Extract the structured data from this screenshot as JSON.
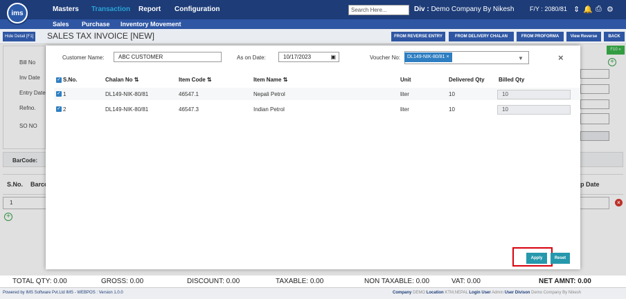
{
  "nav": {
    "menus": [
      "Masters",
      "Transaction",
      "Report",
      "Configuration"
    ],
    "active_menu": "Transaction",
    "submenus": [
      "Sales",
      "Purchase",
      "Inventory Movement"
    ],
    "search_placeholder": "Search Here...",
    "division_label": "Div :",
    "division_value": "Demo Company By Nikesh",
    "fiscal_year": "F/Y : 2080/81",
    "logo_text": "ims"
  },
  "titlebar": {
    "hide_detail": "Hide Detail [F1]",
    "title": "SALES TAX INVOICE [NEW]",
    "buttons": [
      "FROM REVERSE ENTRY",
      "FROM DELIVERY CHALAN",
      "FROM PROFORMA",
      "View Reverse",
      "BACK"
    ]
  },
  "form": {
    "labels": [
      "Bill No",
      "Inv Date",
      "Entry Date",
      "Refno.",
      "SO NO"
    ],
    "f10": "F10 «"
  },
  "barcode_label": "BarCode:",
  "grid": {
    "headers": [
      "S.No.",
      "Barcode",
      "p Date"
    ],
    "row_number": "1"
  },
  "modal": {
    "customer_label": "Customer Name:",
    "customer_value": "ABC CUSTOMER",
    "date_label": "As on Date:",
    "date_value": "10/17/2023",
    "voucher_label": "Voucher No:",
    "voucher_tag": "DL149-NIK-80/81",
    "columns": [
      "S.No.",
      "Chalan No",
      "Item Code",
      "Item Name",
      "Unit",
      "Delivered Qty",
      "Billed Qty"
    ],
    "rows": [
      {
        "sno": "1",
        "chalan": "DL149-NIK-80/81",
        "code": "46547.1",
        "name": "Nepali Petrol",
        "unit": "liter",
        "delivered": "10",
        "billed": "10"
      },
      {
        "sno": "2",
        "chalan": "DL149-NIK-80/81",
        "code": "46547.3",
        "name": "Indian Petrol",
        "unit": "liter",
        "delivered": "10",
        "billed": "10"
      }
    ],
    "apply": "Apply",
    "reset": "Reset"
  },
  "totals": {
    "qty": "TOTAL QTY: 0.00",
    "gross": "GROSS: 0.00",
    "discount": "DISCOUNT: 0.00",
    "taxable": "TAXABLE: 0.00",
    "non_taxable": "NON TAXABLE: 0.00",
    "vat": "VAT: 0.00",
    "net": "NET AMNT: 0.00"
  },
  "footer": {
    "powered": "Powered by IMS Software Pvt.Ltd    IMS - WEBPOS : Version 1.0.0",
    "company_label": "Company",
    "company": "DEMO",
    "location_label": "Location",
    "location": "KTM,NEPAL",
    "login_label": "Login User",
    "login": "Admin",
    "division_label": "User Divison",
    "division": "Demo Company By Nikesh"
  },
  "colors": {
    "nav": "#1d3c78",
    "accent": "#2e56a3",
    "apply": "#2698ac",
    "highlight": "#d8000c"
  }
}
